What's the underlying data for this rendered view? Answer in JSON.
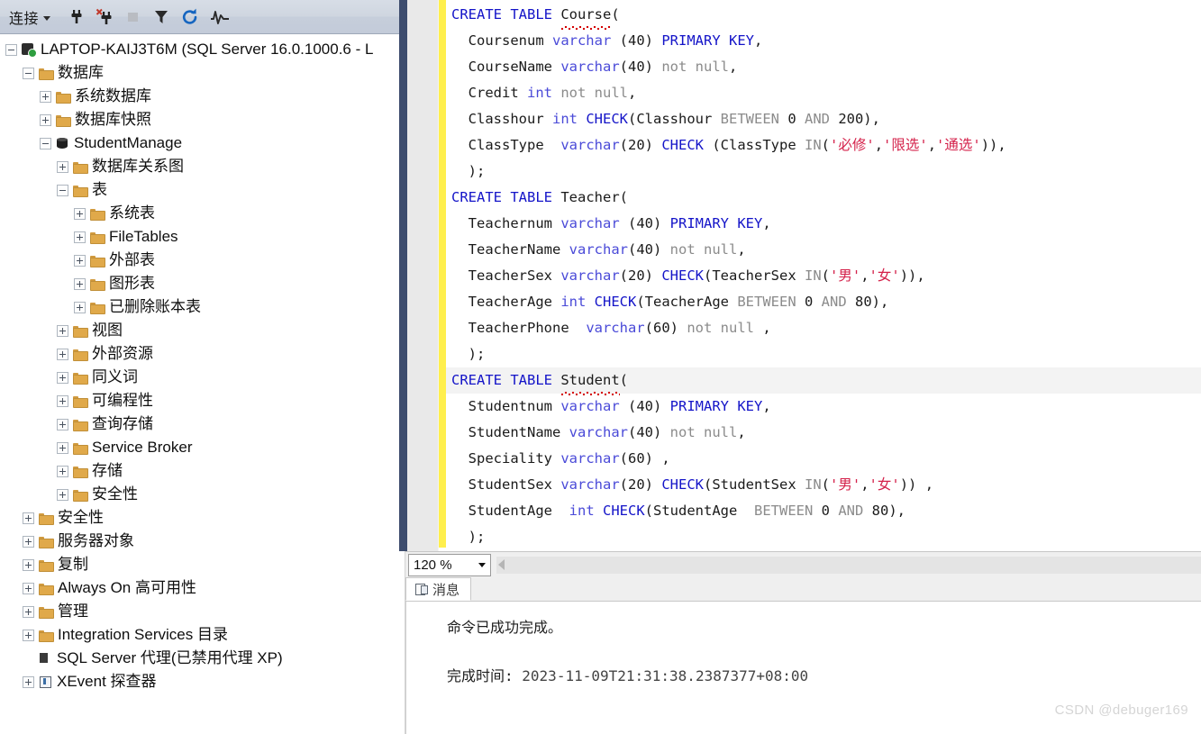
{
  "explorer": {
    "toolbar": {
      "connect_label": "连接",
      "icons": [
        "connect-dropdown",
        "connect-plug-icon",
        "disconnect-plug-icon",
        "stop-icon",
        "filter-icon",
        "refresh-icon",
        "activity-monitor-icon"
      ]
    },
    "tree": [
      {
        "label": "LAPTOP-KAIJ3T6M (SQL Server 16.0.1000.6 - L",
        "indent": 0,
        "state": "minus",
        "icon": "server-icon",
        "name": "tree-node-server"
      },
      {
        "label": "数据库",
        "indent": 1,
        "state": "minus",
        "icon": "folder-icon",
        "name": "tree-node-databases"
      },
      {
        "label": "系统数据库",
        "indent": 2,
        "state": "plus",
        "icon": "folder-icon",
        "name": "tree-node-system-databases"
      },
      {
        "label": "数据库快照",
        "indent": 2,
        "state": "plus",
        "icon": "folder-icon",
        "name": "tree-node-database-snapshots"
      },
      {
        "label": "StudentManage",
        "indent": 2,
        "state": "minus",
        "icon": "database-icon",
        "name": "tree-node-studentmanage"
      },
      {
        "label": "数据库关系图",
        "indent": 3,
        "state": "plus",
        "icon": "folder-icon",
        "name": "tree-node-database-diagrams"
      },
      {
        "label": "表",
        "indent": 3,
        "state": "minus",
        "icon": "folder-icon",
        "name": "tree-node-tables"
      },
      {
        "label": "系统表",
        "indent": 4,
        "state": "plus",
        "icon": "folder-icon",
        "name": "tree-node-system-tables"
      },
      {
        "label": "FileTables",
        "indent": 4,
        "state": "plus",
        "icon": "folder-icon",
        "name": "tree-node-filetables"
      },
      {
        "label": "外部表",
        "indent": 4,
        "state": "plus",
        "icon": "folder-icon",
        "name": "tree-node-external-tables"
      },
      {
        "label": "图形表",
        "indent": 4,
        "state": "plus",
        "icon": "folder-icon",
        "name": "tree-node-graph-tables"
      },
      {
        "label": "已删除账本表",
        "indent": 4,
        "state": "plus",
        "icon": "folder-icon",
        "name": "tree-node-dropped-ledger-tables"
      },
      {
        "label": "视图",
        "indent": 3,
        "state": "plus",
        "icon": "folder-icon",
        "name": "tree-node-views"
      },
      {
        "label": "外部资源",
        "indent": 3,
        "state": "plus",
        "icon": "folder-icon",
        "name": "tree-node-external-resources"
      },
      {
        "label": "同义词",
        "indent": 3,
        "state": "plus",
        "icon": "folder-icon",
        "name": "tree-node-synonyms"
      },
      {
        "label": "可编程性",
        "indent": 3,
        "state": "plus",
        "icon": "folder-icon",
        "name": "tree-node-programmability"
      },
      {
        "label": "查询存储",
        "indent": 3,
        "state": "plus",
        "icon": "folder-icon",
        "name": "tree-node-query-store"
      },
      {
        "label": "Service Broker",
        "indent": 3,
        "state": "plus",
        "icon": "folder-icon",
        "name": "tree-node-service-broker"
      },
      {
        "label": "存储",
        "indent": 3,
        "state": "plus",
        "icon": "folder-icon",
        "name": "tree-node-storage"
      },
      {
        "label": "安全性",
        "indent": 3,
        "state": "plus",
        "icon": "folder-icon",
        "name": "tree-node-db-security"
      },
      {
        "label": "安全性",
        "indent": 1,
        "state": "plus",
        "icon": "folder-icon",
        "name": "tree-node-security"
      },
      {
        "label": "服务器对象",
        "indent": 1,
        "state": "plus",
        "icon": "folder-icon",
        "name": "tree-node-server-objects"
      },
      {
        "label": "复制",
        "indent": 1,
        "state": "plus",
        "icon": "folder-icon",
        "name": "tree-node-replication"
      },
      {
        "label": "Always On 高可用性",
        "indent": 1,
        "state": "plus",
        "icon": "folder-icon",
        "name": "tree-node-always-on"
      },
      {
        "label": "管理",
        "indent": 1,
        "state": "plus",
        "icon": "folder-icon",
        "name": "tree-node-management"
      },
      {
        "label": "Integration Services 目录",
        "indent": 1,
        "state": "plus",
        "icon": "folder-icon",
        "name": "tree-node-integration-services"
      },
      {
        "label": "SQL Server 代理(已禁用代理 XP)",
        "indent": 1,
        "state": "none",
        "icon": "agent-icon",
        "name": "tree-node-sql-agent"
      },
      {
        "label": "XEvent 探查器",
        "indent": 1,
        "state": "plus",
        "icon": "xevent-icon",
        "name": "tree-node-xevent-profiler"
      }
    ]
  },
  "editor": {
    "code": [
      {
        "fold": true,
        "tokens": [
          {
            "t": "CREATE TABLE ",
            "c": "k"
          },
          {
            "t": "Course",
            "c": "n sq"
          },
          {
            "t": "(",
            "c": "n"
          }
        ]
      },
      {
        "tokens": [
          {
            "t": "  Coursenum ",
            "c": "n"
          },
          {
            "t": "varchar",
            "c": "kb"
          },
          {
            "t": " (",
            "c": "n"
          },
          {
            "t": "40",
            "c": "num"
          },
          {
            "t": ") ",
            "c": "n"
          },
          {
            "t": "PRIMARY KEY",
            "c": "k"
          },
          {
            "t": ",",
            "c": "n"
          }
        ]
      },
      {
        "tokens": [
          {
            "t": "  CourseName ",
            "c": "n"
          },
          {
            "t": "varchar",
            "c": "kb"
          },
          {
            "t": "(",
            "c": "n"
          },
          {
            "t": "40",
            "c": "num"
          },
          {
            "t": ") ",
            "c": "n"
          },
          {
            "t": "not null",
            "c": "g"
          },
          {
            "t": ",",
            "c": "n"
          }
        ]
      },
      {
        "tokens": [
          {
            "t": "  Credit ",
            "c": "n"
          },
          {
            "t": "int",
            "c": "kb"
          },
          {
            "t": " ",
            "c": "n"
          },
          {
            "t": "not null",
            "c": "g"
          },
          {
            "t": ",",
            "c": "n"
          }
        ]
      },
      {
        "tokens": [
          {
            "t": "  Classhour ",
            "c": "n"
          },
          {
            "t": "int",
            "c": "kb"
          },
          {
            "t": " ",
            "c": "n"
          },
          {
            "t": "CHECK",
            "c": "k"
          },
          {
            "t": "(Classhour ",
            "c": "n"
          },
          {
            "t": "BETWEEN",
            "c": "g"
          },
          {
            "t": " 0 ",
            "c": "n"
          },
          {
            "t": "AND",
            "c": "g"
          },
          {
            "t": " 200),",
            "c": "n"
          }
        ]
      },
      {
        "tokens": [
          {
            "t": "  ClassType  ",
            "c": "n"
          },
          {
            "t": "varchar",
            "c": "kb"
          },
          {
            "t": "(",
            "c": "n"
          },
          {
            "t": "20",
            "c": "num"
          },
          {
            "t": ") ",
            "c": "n"
          },
          {
            "t": "CHECK",
            "c": "k"
          },
          {
            "t": " (ClassType ",
            "c": "n"
          },
          {
            "t": "IN",
            "c": "g"
          },
          {
            "t": "(",
            "c": "n"
          },
          {
            "t": "'必修'",
            "c": "str"
          },
          {
            "t": ",",
            "c": "n"
          },
          {
            "t": "'限选'",
            "c": "str"
          },
          {
            "t": ",",
            "c": "n"
          },
          {
            "t": "'通选'",
            "c": "str"
          },
          {
            "t": ")),",
            "c": "n"
          }
        ]
      },
      {
        "tokens": [
          {
            "t": "  );",
            "c": "n"
          }
        ]
      },
      {
        "fold": true,
        "tokens": [
          {
            "t": "CREATE TABLE ",
            "c": "k"
          },
          {
            "t": "Teacher",
            "c": "n"
          },
          {
            "t": "(",
            "c": "n"
          }
        ]
      },
      {
        "tokens": [
          {
            "t": "  Teachernum ",
            "c": "n"
          },
          {
            "t": "varchar",
            "c": "kb"
          },
          {
            "t": " (",
            "c": "n"
          },
          {
            "t": "40",
            "c": "num"
          },
          {
            "t": ") ",
            "c": "n"
          },
          {
            "t": "PRIMARY KEY",
            "c": "k"
          },
          {
            "t": ",",
            "c": "n"
          }
        ]
      },
      {
        "tokens": [
          {
            "t": "  TeacherName ",
            "c": "n"
          },
          {
            "t": "varchar",
            "c": "kb"
          },
          {
            "t": "(",
            "c": "n"
          },
          {
            "t": "40",
            "c": "num"
          },
          {
            "t": ") ",
            "c": "n"
          },
          {
            "t": "not null",
            "c": "g"
          },
          {
            "t": ",",
            "c": "n"
          }
        ]
      },
      {
        "tokens": [
          {
            "t": "  TeacherSex ",
            "c": "n"
          },
          {
            "t": "varchar",
            "c": "kb"
          },
          {
            "t": "(",
            "c": "n"
          },
          {
            "t": "20",
            "c": "num"
          },
          {
            "t": ") ",
            "c": "n"
          },
          {
            "t": "CHECK",
            "c": "k"
          },
          {
            "t": "(TeacherSex ",
            "c": "n"
          },
          {
            "t": "IN",
            "c": "g"
          },
          {
            "t": "(",
            "c": "n"
          },
          {
            "t": "'男'",
            "c": "str"
          },
          {
            "t": ",",
            "c": "n"
          },
          {
            "t": "'女'",
            "c": "str"
          },
          {
            "t": ")),",
            "c": "n"
          }
        ]
      },
      {
        "tokens": [
          {
            "t": "  TeacherAge ",
            "c": "n"
          },
          {
            "t": "int",
            "c": "kb"
          },
          {
            "t": " ",
            "c": "n"
          },
          {
            "t": "CHECK",
            "c": "k"
          },
          {
            "t": "(TeacherAge ",
            "c": "n"
          },
          {
            "t": "BETWEEN",
            "c": "g"
          },
          {
            "t": " 0 ",
            "c": "n"
          },
          {
            "t": "AND",
            "c": "g"
          },
          {
            "t": " 80),",
            "c": "n"
          }
        ]
      },
      {
        "tokens": [
          {
            "t": "  TeacherPhone  ",
            "c": "n"
          },
          {
            "t": "varchar",
            "c": "kb"
          },
          {
            "t": "(",
            "c": "n"
          },
          {
            "t": "60",
            "c": "num"
          },
          {
            "t": ") ",
            "c": "n"
          },
          {
            "t": "not null",
            "c": "g"
          },
          {
            "t": " ,",
            "c": "n"
          }
        ]
      },
      {
        "tokens": [
          {
            "t": "  );",
            "c": "n"
          }
        ]
      },
      {
        "fold": true,
        "hl": true,
        "tokens": [
          {
            "t": "CREATE TABLE ",
            "c": "k"
          },
          {
            "t": "Student",
            "c": "n sq"
          },
          {
            "t": "(",
            "c": "n"
          }
        ]
      },
      {
        "tokens": [
          {
            "t": "  Studentnum ",
            "c": "n"
          },
          {
            "t": "varchar",
            "c": "kb"
          },
          {
            "t": " (",
            "c": "n"
          },
          {
            "t": "40",
            "c": "num"
          },
          {
            "t": ") ",
            "c": "n"
          },
          {
            "t": "PRIMARY KEY",
            "c": "k"
          },
          {
            "t": ",",
            "c": "n"
          }
        ]
      },
      {
        "tokens": [
          {
            "t": "  StudentName ",
            "c": "n"
          },
          {
            "t": "varchar",
            "c": "kb"
          },
          {
            "t": "(",
            "c": "n"
          },
          {
            "t": "40",
            "c": "num"
          },
          {
            "t": ") ",
            "c": "n"
          },
          {
            "t": "not null",
            "c": "g"
          },
          {
            "t": ",",
            "c": "n"
          }
        ]
      },
      {
        "tokens": [
          {
            "t": "  Speciality ",
            "c": "n"
          },
          {
            "t": "varchar",
            "c": "kb"
          },
          {
            "t": "(",
            "c": "n"
          },
          {
            "t": "60",
            "c": "num"
          },
          {
            "t": ") ,",
            "c": "n"
          }
        ]
      },
      {
        "tokens": [
          {
            "t": "  StudentSex ",
            "c": "n"
          },
          {
            "t": "varchar",
            "c": "kb"
          },
          {
            "t": "(",
            "c": "n"
          },
          {
            "t": "20",
            "c": "num"
          },
          {
            "t": ") ",
            "c": "n"
          },
          {
            "t": "CHECK",
            "c": "k"
          },
          {
            "t": "(StudentSex ",
            "c": "n"
          },
          {
            "t": "IN",
            "c": "g"
          },
          {
            "t": "(",
            "c": "n"
          },
          {
            "t": "'男'",
            "c": "str"
          },
          {
            "t": ",",
            "c": "n"
          },
          {
            "t": "'女'",
            "c": "str"
          },
          {
            "t": ")) ,",
            "c": "n"
          }
        ]
      },
      {
        "tokens": [
          {
            "t": "  StudentAge  ",
            "c": "n"
          },
          {
            "t": "int",
            "c": "kb"
          },
          {
            "t": " ",
            "c": "n"
          },
          {
            "t": "CHECK",
            "c": "k"
          },
          {
            "t": "(StudentAge  ",
            "c": "n"
          },
          {
            "t": "BETWEEN",
            "c": "g"
          },
          {
            "t": " 0 ",
            "c": "n"
          },
          {
            "t": "AND",
            "c": "g"
          },
          {
            "t": " 80),",
            "c": "n"
          }
        ]
      },
      {
        "tokens": [
          {
            "t": "  );",
            "c": "n"
          }
        ]
      }
    ]
  },
  "zoombar": {
    "zoom_value": "120 %"
  },
  "results": {
    "tab_label": "消息",
    "message": "命令已成功完成。",
    "completion_label": "完成时间:",
    "completion_time": "2023-11-09T21:31:38.2387377+08:00"
  },
  "watermark": "CSDN @debuger169",
  "colors": {
    "keyword_blue": "#1414c8",
    "type_blue": "#4a4ad8",
    "comment_gray": "#8b8b8b",
    "string_red": "#d4214a",
    "change_bar_yellow": "#ffef4d",
    "scrollbar_navy": "#3d4c6d",
    "folder_orange": "#e0a94a"
  }
}
